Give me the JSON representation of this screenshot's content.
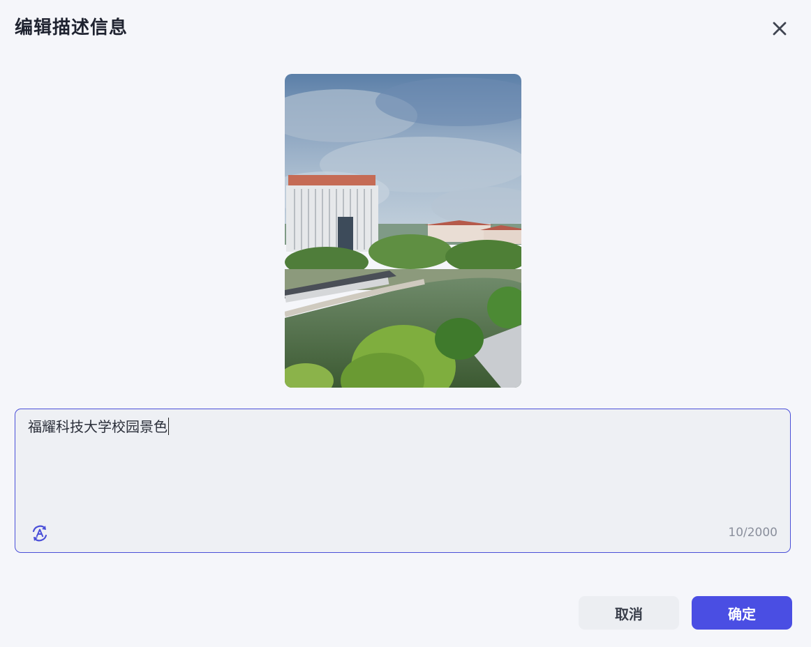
{
  "dialog": {
    "title": "编辑描述信息",
    "close_icon": "close-icon"
  },
  "image": {
    "alt": "campus photo"
  },
  "description": {
    "value": "福耀科技大学校园景色",
    "counter": "10/2000",
    "ai_icon": "ai-rewrite-icon"
  },
  "actions": {
    "cancel_label": "取消",
    "confirm_label": "确定"
  },
  "colors": {
    "accent": "#4a4ee3",
    "border": "#4a4fd8",
    "background": "#f5f6fa"
  }
}
